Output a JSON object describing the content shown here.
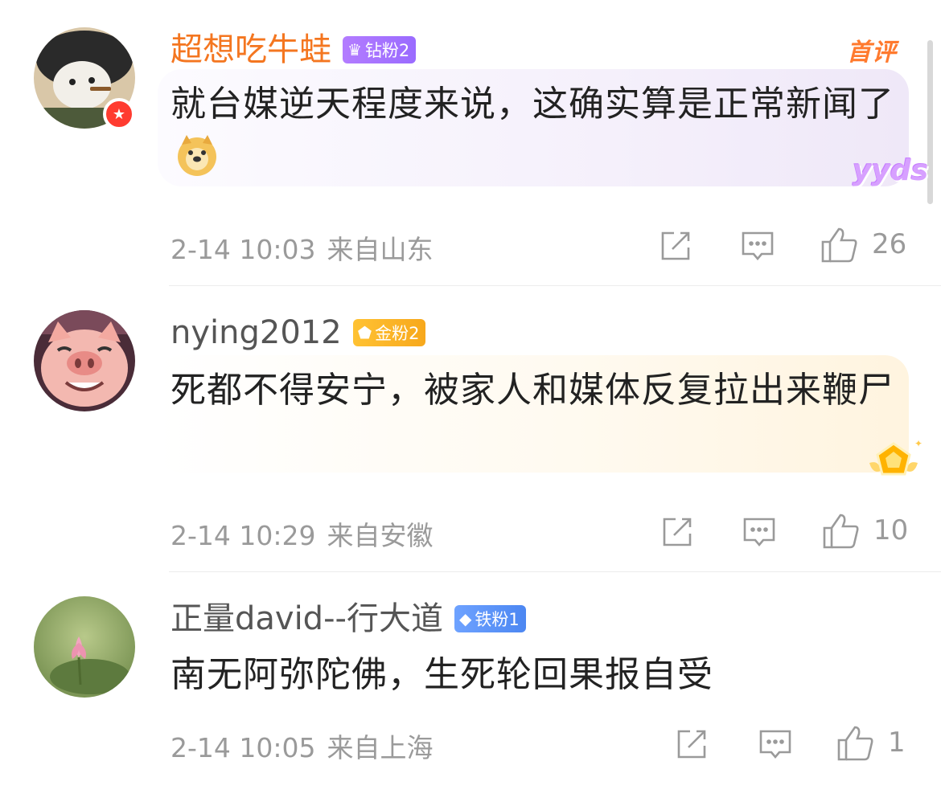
{
  "comments": [
    {
      "username": "超想吃牛蛙",
      "fan_badge": "钻粉2",
      "text": "就台媒逆天程度来说，这确实算是正常新闻了",
      "timestamp": "2-14 10:03",
      "location": "来自山东",
      "likes": "26",
      "tag": "首评",
      "sticker": "yyds"
    },
    {
      "username": "nying2012",
      "fan_badge": "金粉2",
      "text": "死都不得安宁，被家人和媒体反复拉出来鞭尸",
      "timestamp": "2-14 10:29",
      "location": "来自安徽",
      "likes": "10"
    },
    {
      "username": "正量david--行大道",
      "fan_badge": "铁粉1",
      "text": "南无阿弥陀佛，生死轮回果报自受",
      "timestamp": "2-14 10:05",
      "location": "来自上海",
      "likes": "1"
    }
  ],
  "icons": {
    "share": "share-icon",
    "reply": "comment-icon",
    "like": "thumbs-up-icon"
  },
  "colors": {
    "username_highlight": "#f47620",
    "meta_gray": "#9a9a9a",
    "diamond_badge": "#9a6bff",
    "gold_badge": "#f7a81c",
    "iron_badge": "#4c87f2"
  }
}
